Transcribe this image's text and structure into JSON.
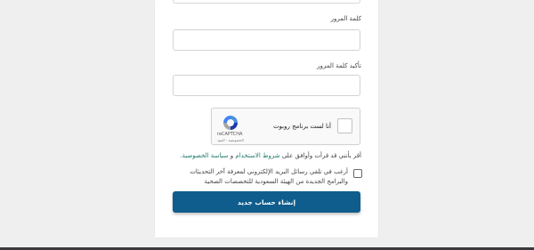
{
  "form": {
    "password_label": "كلمة المرور",
    "password_value": "",
    "confirm_label": "تأكيد كلمة المرور",
    "confirm_value": "",
    "captcha": {
      "checkbox_text": "أنا لست برنامج روبوت",
      "brand": "reCAPTCHA",
      "links": "الخصوصية - البنود",
      "icon": "recaptcha-logo"
    },
    "agree_prefix": "أقر بأنني قد قرأت وأوافق على",
    "agree_terms": "شروط الاستخدام",
    "agree_and": "و",
    "agree_privacy": "سياسة الخصوصية.",
    "subscribe_text": "أرغب في تلقي رسائل البريد الإلكتروني لمعرفة آخر التحديثات والبرامج الجديدة من الهيئة السعودية للتخصصات الصحية",
    "submit_label": "إنشاء حساب جديد"
  },
  "colors": {
    "primary": "#0f5d8c",
    "link": "#1f7a6a",
    "background": "#efefef"
  }
}
